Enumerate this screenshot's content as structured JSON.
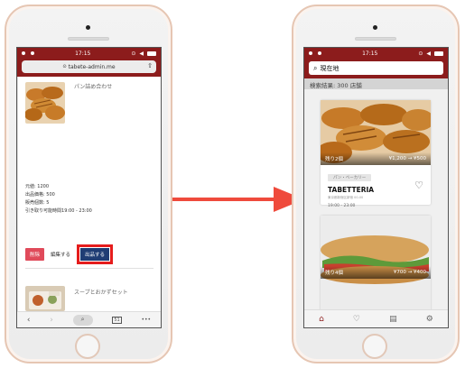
{
  "left_phone": {
    "status": {
      "time": "17:15",
      "icons": "⊙ ◀"
    },
    "url": "tabete-admin.me",
    "product1": {
      "name": "パン詰め合わせ",
      "price_label": "元値:",
      "price": "1200",
      "sale_label": "出品価格:",
      "sale": "500",
      "qty_label": "販売個数:",
      "qty": "5",
      "pickup_label": "引き取り可能時間",
      "pickup": "19:00 - 23:00",
      "delete_label": "削除",
      "edit_label": "編集する",
      "publish_label": "出品する"
    },
    "product2": {
      "name": "スープとおかずセット"
    },
    "toolbar": {
      "tabs_count": "51",
      "more": "•••"
    }
  },
  "right_phone": {
    "status": {
      "time": "17:15",
      "icons": "⊙ ◀"
    },
    "search_placeholder": "現在地",
    "result_count": "検索結果: 300 店舗",
    "card1": {
      "stock": "残り2個",
      "price": "¥1,200 → ¥500",
      "category": "パン・ベーカリー",
      "shop": "TABETTERIA",
      "address": "東京都新宿区新宿 00-00",
      "hours": "19:00 - 23:00"
    },
    "card2": {
      "stock": "残り4個",
      "price": "¥700 → ¥400"
    }
  }
}
